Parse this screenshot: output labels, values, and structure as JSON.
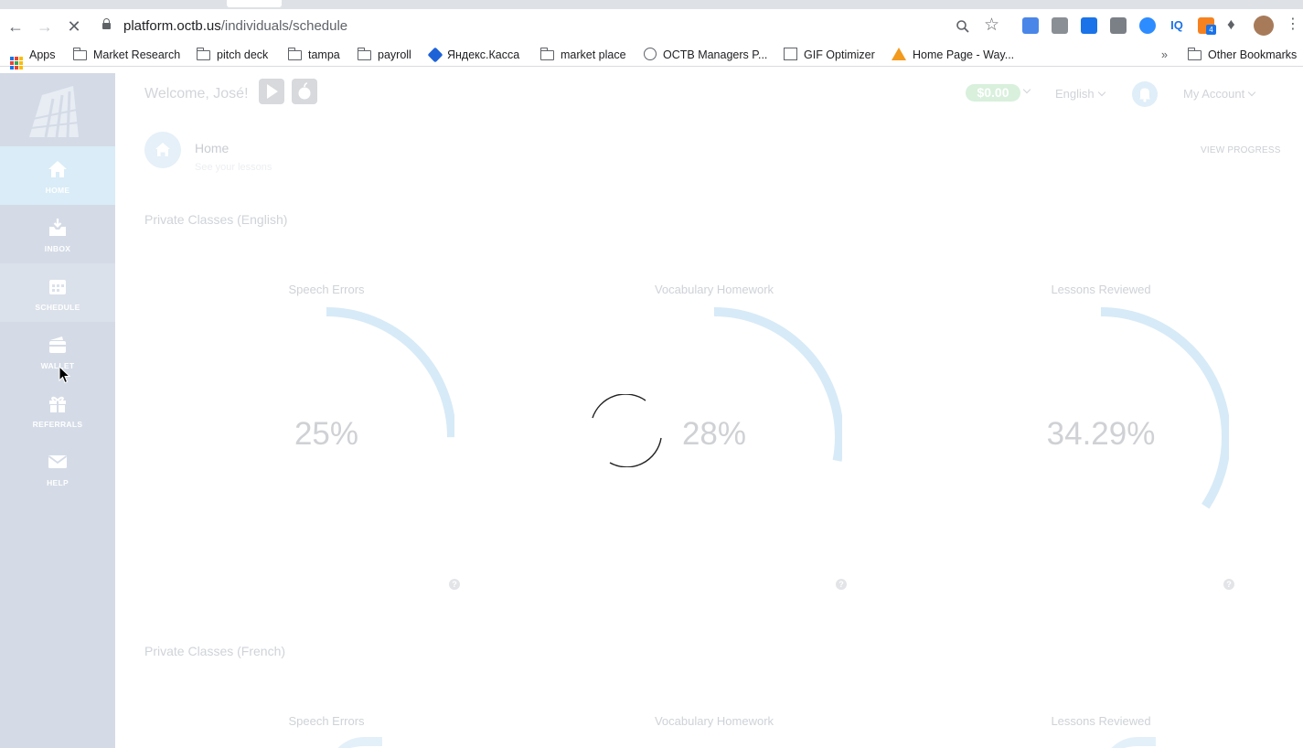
{
  "browser": {
    "url_host": "platform.octb.us",
    "url_path": "/individuals/schedule",
    "bookmarks": [
      {
        "label": "Apps",
        "icon": "apps-grid-icon"
      },
      {
        "label": "Market Research",
        "icon": "folder-icon"
      },
      {
        "label": "pitch deck",
        "icon": "folder-icon"
      },
      {
        "label": "tampa",
        "icon": "folder-icon"
      },
      {
        "label": "payroll",
        "icon": "folder-icon"
      },
      {
        "label": "Яндекс.Касса",
        "icon": "yandex-kassa-icon"
      },
      {
        "label": "market place",
        "icon": "folder-icon"
      },
      {
        "label": "OCTB Managers P...",
        "icon": "globe-icon"
      },
      {
        "label": "GIF Optimizer",
        "icon": "gif-optimizer-icon"
      },
      {
        "label": "Home Page - Way...",
        "icon": "wayfair-icon"
      }
    ],
    "overflow_label": "»",
    "other_bookmarks": "Other Bookmarks",
    "extension_badge": "4",
    "iq_label": "IQ"
  },
  "sidebar": {
    "items": [
      {
        "label": "HOME",
        "icon": "home-icon"
      },
      {
        "label": "INBOX",
        "icon": "inbox-icon"
      },
      {
        "label": "SCHEDULE",
        "icon": "schedule-icon"
      },
      {
        "label": "WALLET",
        "icon": "wallet-icon"
      },
      {
        "label": "REFERRALS",
        "icon": "gift-icon"
      },
      {
        "label": "HELP",
        "icon": "mail-icon"
      }
    ]
  },
  "header": {
    "welcome": "Welcome, José!",
    "balance": "$0.00",
    "language": "English",
    "account": "My Account"
  },
  "breadcrumb": {
    "title": "Home",
    "subtitle": "See your lessons",
    "view_progress": "VIEW PROGRESS"
  },
  "sections": [
    {
      "title": "Private Classes (English)",
      "gauges": [
        {
          "label": "Speech Errors",
          "value_text": "25%",
          "fraction": 0.25
        },
        {
          "label": "Vocabulary Homework",
          "value_text": "28%",
          "fraction": 0.28
        },
        {
          "label": "Lessons Reviewed",
          "value_text": "34.29%",
          "fraction": 0.3429
        }
      ]
    },
    {
      "title": "Private Classes (French)",
      "gauges": [
        {
          "label": "Speech Errors"
        },
        {
          "label": "Vocabulary Homework"
        },
        {
          "label": "Lessons Reviewed"
        }
      ]
    }
  ],
  "help_glyph": "?",
  "colors": {
    "gauge_arc": "#d7eaf7",
    "sidebar_bg": "#d4dbe6",
    "active_item": "#d9ecf7",
    "balance_pill": "#d8f0dc"
  }
}
